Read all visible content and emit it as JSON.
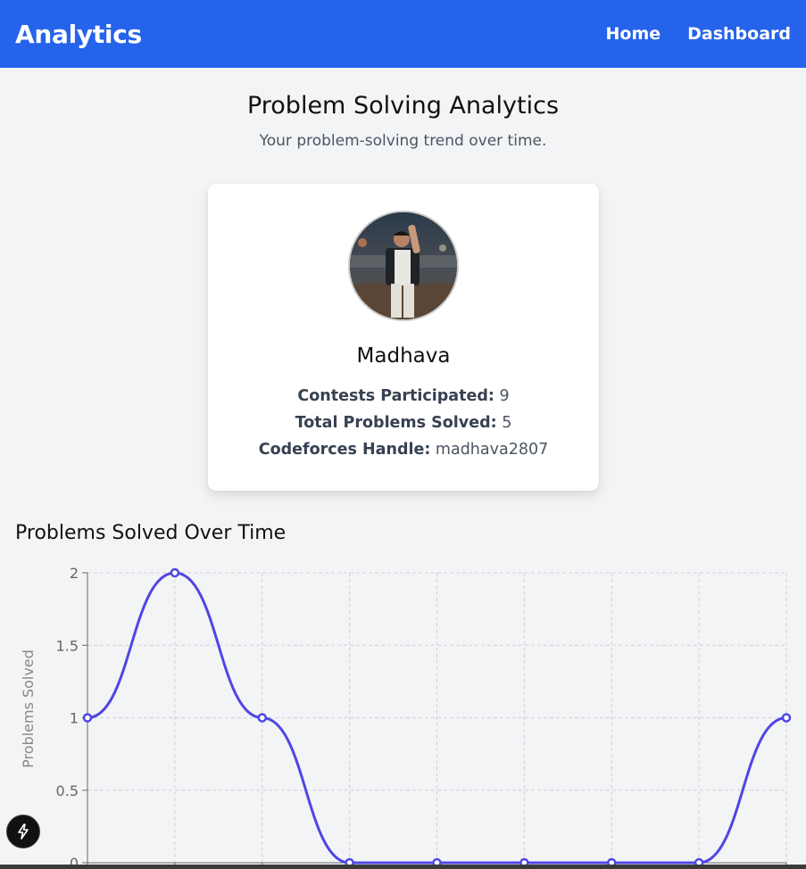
{
  "navbar": {
    "brand": "Analytics",
    "links": [
      "Home",
      "Dashboard"
    ],
    "color": "#2563eb"
  },
  "header": {
    "title": "Problem Solving Analytics",
    "subtitle": "Your problem-solving trend over time."
  },
  "profile": {
    "name": "Madhava",
    "stats": [
      {
        "label": "Contests Participated:",
        "value": "9"
      },
      {
        "label": "Total Problems Solved:",
        "value": "5"
      },
      {
        "label": "Codeforces Handle:",
        "value": "madhava2807"
      }
    ]
  },
  "chart_section": {
    "title": "Problems Solved Over Time"
  },
  "chart_data": {
    "type": "line",
    "ylabel": "Problems Solved",
    "xlabel": "",
    "ylim": [
      0,
      2
    ],
    "yticks": [
      "0",
      "0.5",
      "1",
      "1.5",
      "2"
    ],
    "values": [
      1,
      2,
      1,
      0,
      0,
      0,
      0,
      0,
      1
    ],
    "line_color": "#4f46e5",
    "grid": true,
    "curve": "smooth"
  },
  "dev_badge": {
    "icon": "lightning-icon"
  }
}
